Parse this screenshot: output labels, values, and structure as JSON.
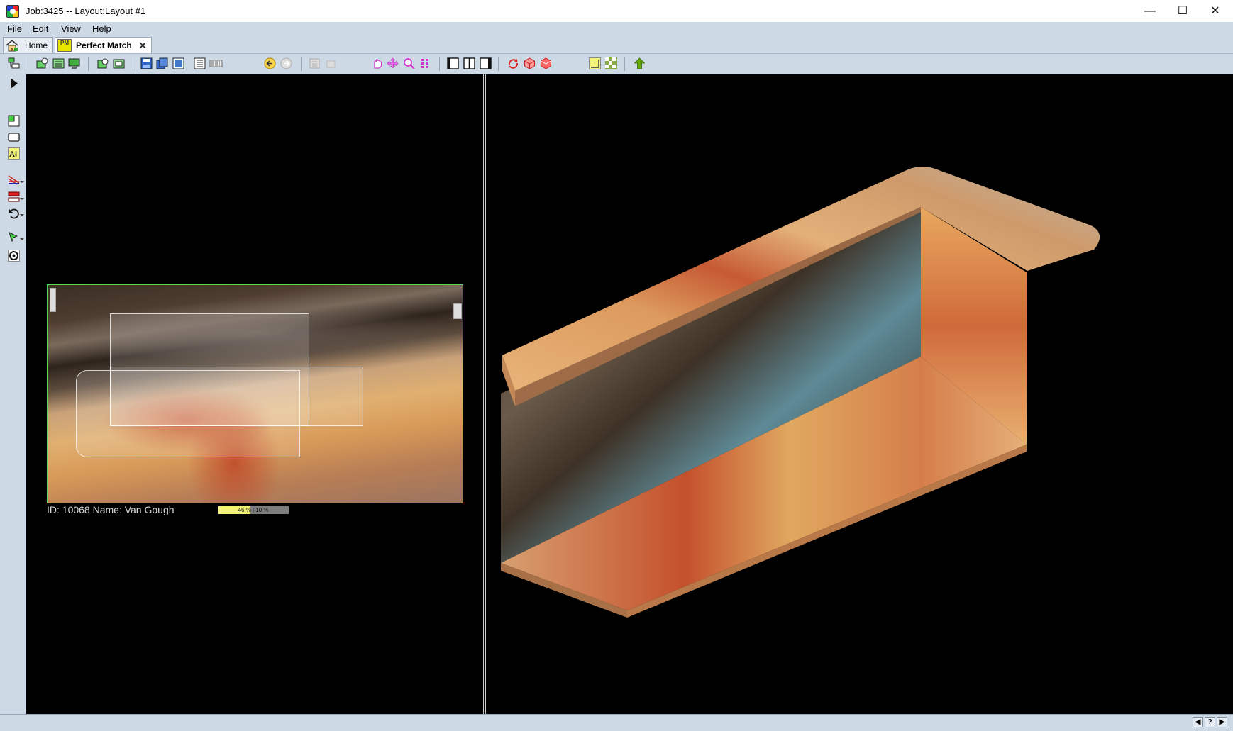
{
  "window": {
    "title": "Job:3425 -- Layout:Layout #1",
    "minimize": "—",
    "maximize": "☐",
    "close": "✕"
  },
  "menu": [
    {
      "label": "File"
    },
    {
      "label": "Edit"
    },
    {
      "label": "View"
    },
    {
      "label": "Help"
    }
  ],
  "tabs": {
    "home": "Home",
    "perfect_match": "Perfect Match",
    "pm_icon": "PM",
    "close": "✕"
  },
  "slab": {
    "caption": "ID: 10068 Name: Van Gough",
    "progress_left": "46 %",
    "progress_right": "10 %",
    "progress_fraction": 0.46
  },
  "colors": {
    "chrome": "#ced9e6",
    "viewport": "#000000",
    "slab_border": "#5ad65a",
    "progress": "#f2f27a"
  },
  "icons": {
    "toolbar": [
      "layout-icon",
      "add-slab-icon",
      "slab-list-icon",
      "slab-display-icon",
      "slab-search-icon",
      "slab-inventory-icon",
      "save-icon",
      "save-all-icon",
      "export-icon",
      "print-icon",
      "barcode-icon",
      "back-arrow-icon",
      "forward-arrow-icon",
      "copy-icon",
      "paste-icon",
      "pan-hand-icon",
      "move-icon",
      "zoom-icon",
      "grid-icon",
      "single-pane-icon",
      "split-pane-icon",
      "left-pane-icon",
      "rotate-icon",
      "3d-box-icon",
      "3d-solid-icon",
      "seam-icon",
      "texture-icon",
      "up-arrow-icon"
    ],
    "vertical": [
      "play-icon",
      "piece-icon",
      "rectangle-icon",
      "text-icon",
      "measure-icon",
      "layers-icon",
      "undo-icon",
      "select-icon",
      "target-icon"
    ],
    "status": [
      "prev-icon",
      "help-icon",
      "next-icon"
    ]
  },
  "status": {
    "prev": "◀",
    "help": "?",
    "next": "▶"
  }
}
